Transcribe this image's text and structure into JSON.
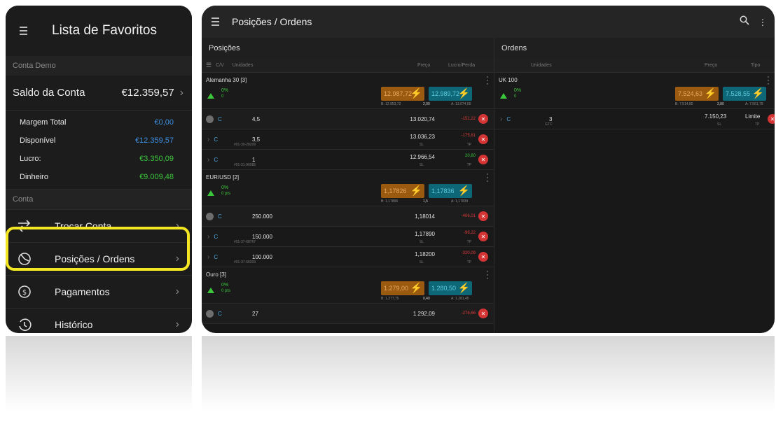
{
  "left": {
    "title": "Lista de Favoritos",
    "section_demo": "Conta Demo",
    "saldo_label": "Saldo da Conta",
    "saldo_value": "€12.359,57",
    "rows": [
      {
        "label": "Margem Total",
        "value": "€0,00",
        "color": "#3d8fe0"
      },
      {
        "label": "Disponível",
        "value": "€12.359,57",
        "color": "#3d8fe0"
      },
      {
        "label": "Lucro:",
        "value": "€3.350,09",
        "color": "#3cc63c"
      },
      {
        "label": "Dinheiro",
        "value": "€9.009,48",
        "color": "#3cc63c"
      }
    ],
    "section_conta": "Conta",
    "nav": [
      {
        "label": "Trocar Conta",
        "icon": "swap-icon"
      },
      {
        "label": "Posições / Ordens",
        "icon": "pie-chart-icon"
      },
      {
        "label": "Pagamentos",
        "icon": "dollar-coin-icon"
      },
      {
        "label": "Histórico",
        "icon": "history-icon"
      }
    ]
  },
  "right": {
    "title": "Posições / Ordens",
    "positions": {
      "header": "Posições",
      "col_cv": "C/V",
      "col_units": "Unidades",
      "col_price": "Preço",
      "col_pl": "Lucro/Perda",
      "instruments": [
        {
          "name": "Alemanha 30 [3]",
          "pct": "0%",
          "pct2": "0",
          "sell": "12.987,72",
          "buy": "12.989,72",
          "low": "B: 12.953,72",
          "spread": "2,00",
          "high": "A: 13.074,05",
          "summary": {
            "side": "C",
            "units": "4,5",
            "price": "13.020,74",
            "pl": "-151,22"
          },
          "subs": [
            {
              "side": "C",
              "units": "3,5",
              "id": "#01-30-28209",
              "price": "13.036,23",
              "sl": "SL",
              "pl": "-175,81",
              "tp": "TP"
            },
            {
              "side": "C",
              "units": "1",
              "id": "#01-31-96085",
              "price": "12.966,54",
              "sl": "SL",
              "pl": "20,60",
              "tp": "TP"
            }
          ]
        },
        {
          "name": "EUR/USD [2]",
          "pct": "0%",
          "pct2": "0 pts",
          "sell": "1,17826",
          "buy": "1,17836",
          "low": "B: 1,17806",
          "spread": "1,5",
          "high": "A: 1,17839",
          "summary": {
            "side": "C",
            "units": "250.000",
            "price": "1,18014",
            "pl": "-406,01"
          },
          "subs": [
            {
              "side": "C",
              "units": "150.000",
              "id": "#01-37-68767",
              "price": "1,17890",
              "sl": "SL",
              "pl": "-98,22",
              "tp": "TP"
            },
            {
              "side": "C",
              "units": "100.000",
              "id": "#01-37-68303",
              "price": "1,18200",
              "sl": "SL",
              "pl": "-320,09",
              "tp": "TP"
            }
          ]
        },
        {
          "name": "Ouro [3]",
          "pct": "0%",
          "pct2": "0 pts",
          "sell": "1.279,00",
          "buy": "1.280,50",
          "low": "B: 1.277,75",
          "spread": "0,40",
          "high": "A: 1.281,45",
          "summary": {
            "side": "C",
            "units": "27",
            "price": "1.292,09",
            "pl": "-278,66"
          },
          "subs": []
        }
      ]
    },
    "orders": {
      "header": "Ordens",
      "col_units": "Unidades",
      "col_price": "Preço",
      "col_type": "Tipo",
      "instrument": {
        "name": "UK 100",
        "pct": "0%",
        "pct2": "0",
        "sell": "7.524,63",
        "buy": "7.528,55",
        "low": "B: 7.514,80",
        "spread": "3,80",
        "high": "A: 7.561,79"
      },
      "row": {
        "side": "C",
        "units": "3",
        "sub": "GTC",
        "price": "7.150,23",
        "sl": "SL",
        "type": "Limite",
        "tp": "TP"
      }
    }
  },
  "colors": {
    "highlight": "#f3e623",
    "green": "#3cc63c",
    "red": "#d53434",
    "blue": "#3d8fe0"
  }
}
